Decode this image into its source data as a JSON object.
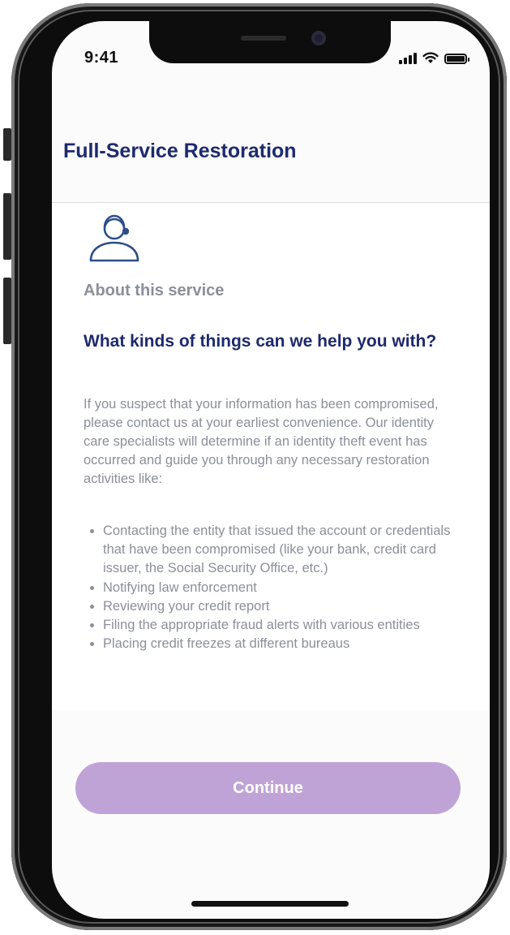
{
  "status_bar": {
    "time": "9:41",
    "signal_icon": "cellular-signal-icon",
    "wifi_icon": "wifi-icon",
    "battery_icon": "battery-icon"
  },
  "header": {
    "title": "Full-Service Restoration"
  },
  "service": {
    "icon": "customer-support-headset-icon",
    "about_label": "About this service",
    "question": "What kinds of things can we help you with?",
    "intro": "If you suspect that your information has been compromised, please contact us at your earliest convenience. Our identity care specialists will determine if an identity theft event has occurred and guide you through any necessary restoration activities like:",
    "bullets": [
      "Contacting the entity that issued the account or credentials that have been compromised (like your bank, credit card issuer, the Social Security Office, etc.)",
      "Notifying law enforcement",
      "Reviewing your credit report",
      "Filing the appropriate fraud alerts with various entities",
      "Placing credit freezes at different bureaus"
    ]
  },
  "actions": {
    "continue_label": "Continue"
  },
  "colors": {
    "title": "#1d2a6e",
    "button": "#bfa3d6",
    "body_text": "#8c8f98"
  }
}
